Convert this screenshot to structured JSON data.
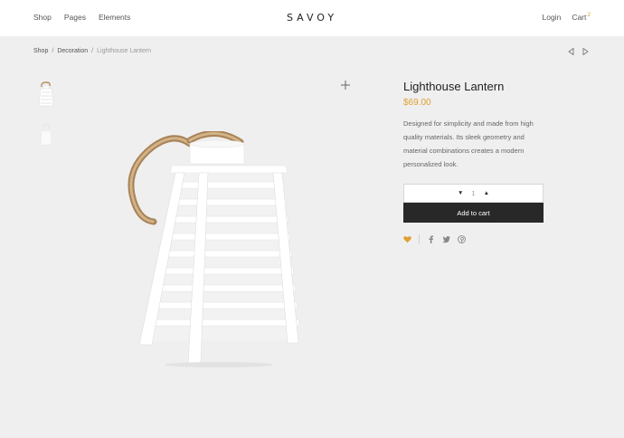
{
  "header": {
    "nav_left": [
      "Shop",
      "Pages",
      "Elements"
    ],
    "logo": "SAVOY",
    "login": "Login",
    "cart_label": "Cart",
    "cart_count": "2"
  },
  "breadcrumb": {
    "items": [
      "Shop",
      "Decoration",
      "Lighthouse Lantern"
    ],
    "separator": "/"
  },
  "gallery": {
    "thumbnails": [
      "lantern-thumb",
      "lantern-side-thumb"
    ],
    "zoom_icon": "plus-icon",
    "main_image": "lighthouse-lantern"
  },
  "product": {
    "title": "Lighthouse Lantern",
    "price": "$69.00",
    "description": "Designed for simplicity and made from high quality materials. Its sleek geometry and material combinations creates a modern personalized look.",
    "quantity": "1",
    "qty_down": "▼",
    "qty_up": "▲",
    "add_to_cart": "Add to cart"
  },
  "social": {
    "icons": [
      "heart-icon",
      "facebook-icon",
      "twitter-icon",
      "pinterest-icon"
    ]
  },
  "colors": {
    "accent": "#e0a030",
    "background": "#efefef",
    "button": "#282828"
  }
}
